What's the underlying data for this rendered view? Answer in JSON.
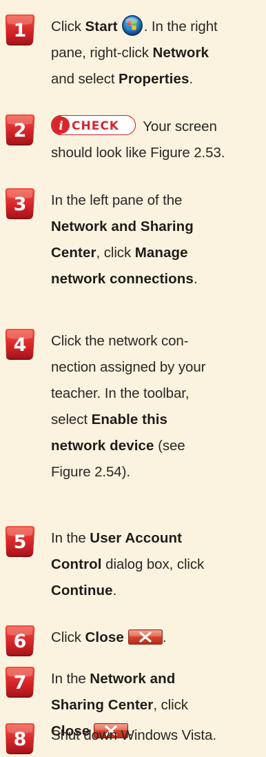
{
  "steps": [
    {
      "number": "1",
      "l1_a": "Click ",
      "l1_b": "Start",
      "l1_c": ". In the right",
      "l2_a": "pane, right-click ",
      "l2_b": "Network",
      "l3_a": "and select ",
      "l3_b": "Properties",
      "l3_c": "."
    },
    {
      "number": "2",
      "check_logo": "CHECK",
      "l1_a": " Your screen",
      "l2_a": "should look like Figure 2.53."
    },
    {
      "number": "3",
      "l1_a": "In the left pane of the",
      "l2_b": "Network and Sharing",
      "l3_b": "Center",
      "l3_c": ", click ",
      "l3_d": "Manage",
      "l4_b": "network connections",
      "l4_c": "."
    },
    {
      "number": "4",
      "l1_a": "Click the network con-",
      "l2_a": "nection assigned by your",
      "l3_a": "teacher. In the toolbar,",
      "l4_a": "select ",
      "l4_b": "Enable this",
      "l5_b": "network device",
      "l5_c": " (see",
      "l6_a": "Figure 2.54)."
    },
    {
      "number": "5",
      "l1_a": "In the ",
      "l1_b": "User Account",
      "l2_b": "Control",
      "l2_c": " dialog box, click",
      "l3_b": "Continue",
      "l3_c": "."
    },
    {
      "number": "6",
      "l1_a": "Click ",
      "l1_b": "Close",
      "l1_c": "."
    },
    {
      "number": "7",
      "l1_a": "In the ",
      "l1_b": "Network and",
      "l2_b": "Sharing Center",
      "l2_c": ", click",
      "l3_b": "Close",
      "l3_c": "."
    },
    {
      "number": "8",
      "l1_a": "Shut down Windows Vista."
    }
  ],
  "icons": {
    "step_badge": "red-rounded-square-number-badge",
    "start": "windows-vista-start-orb-icon",
    "check": "check-logo-icon",
    "close": "window-close-button-icon"
  },
  "colors": {
    "background": "#fbf3e0",
    "badge_red": "#d8262a",
    "text": "#2b2622",
    "close_red": "#d9442c"
  }
}
